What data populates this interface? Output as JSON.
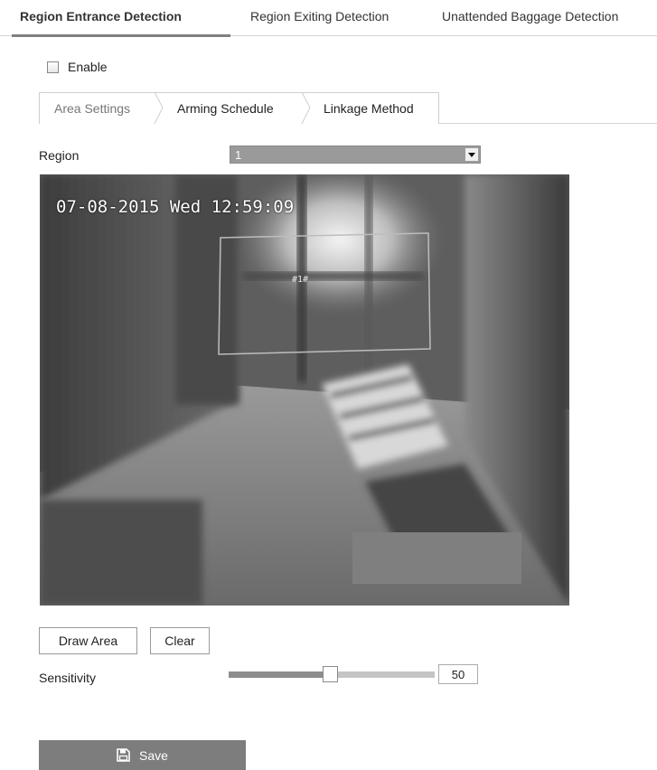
{
  "top_tabs": [
    {
      "label": "Region Entrance Detection",
      "active": true
    },
    {
      "label": "Region Exiting Detection",
      "active": false
    },
    {
      "label": "Unattended Baggage Detection",
      "active": false
    }
  ],
  "enable": {
    "label": "Enable",
    "checked": false
  },
  "sub_tabs": [
    {
      "label": "Area Settings",
      "active": true
    },
    {
      "label": "Arming Schedule",
      "active": false
    },
    {
      "label": "Linkage Method",
      "active": false
    }
  ],
  "region": {
    "label": "Region",
    "selected": "1"
  },
  "video": {
    "osd_date": "07-08-2015",
    "osd_day": "Wed",
    "osd_time": "12:59:09",
    "region_tag": "#1#"
  },
  "buttons": {
    "draw_area": "Draw Area",
    "clear": "Clear",
    "save": "Save"
  },
  "sensitivity": {
    "label": "Sensitivity",
    "value": "50",
    "level_percent": 50
  },
  "icons": {
    "save": "floppy-disk-icon",
    "dropdown": "chevron-down-icon",
    "checkbox": "checkbox-icon"
  },
  "colors": {
    "save_button": "#7d7d7d",
    "select_bg": "#9a9a9a",
    "tab_underline": "#808080"
  }
}
